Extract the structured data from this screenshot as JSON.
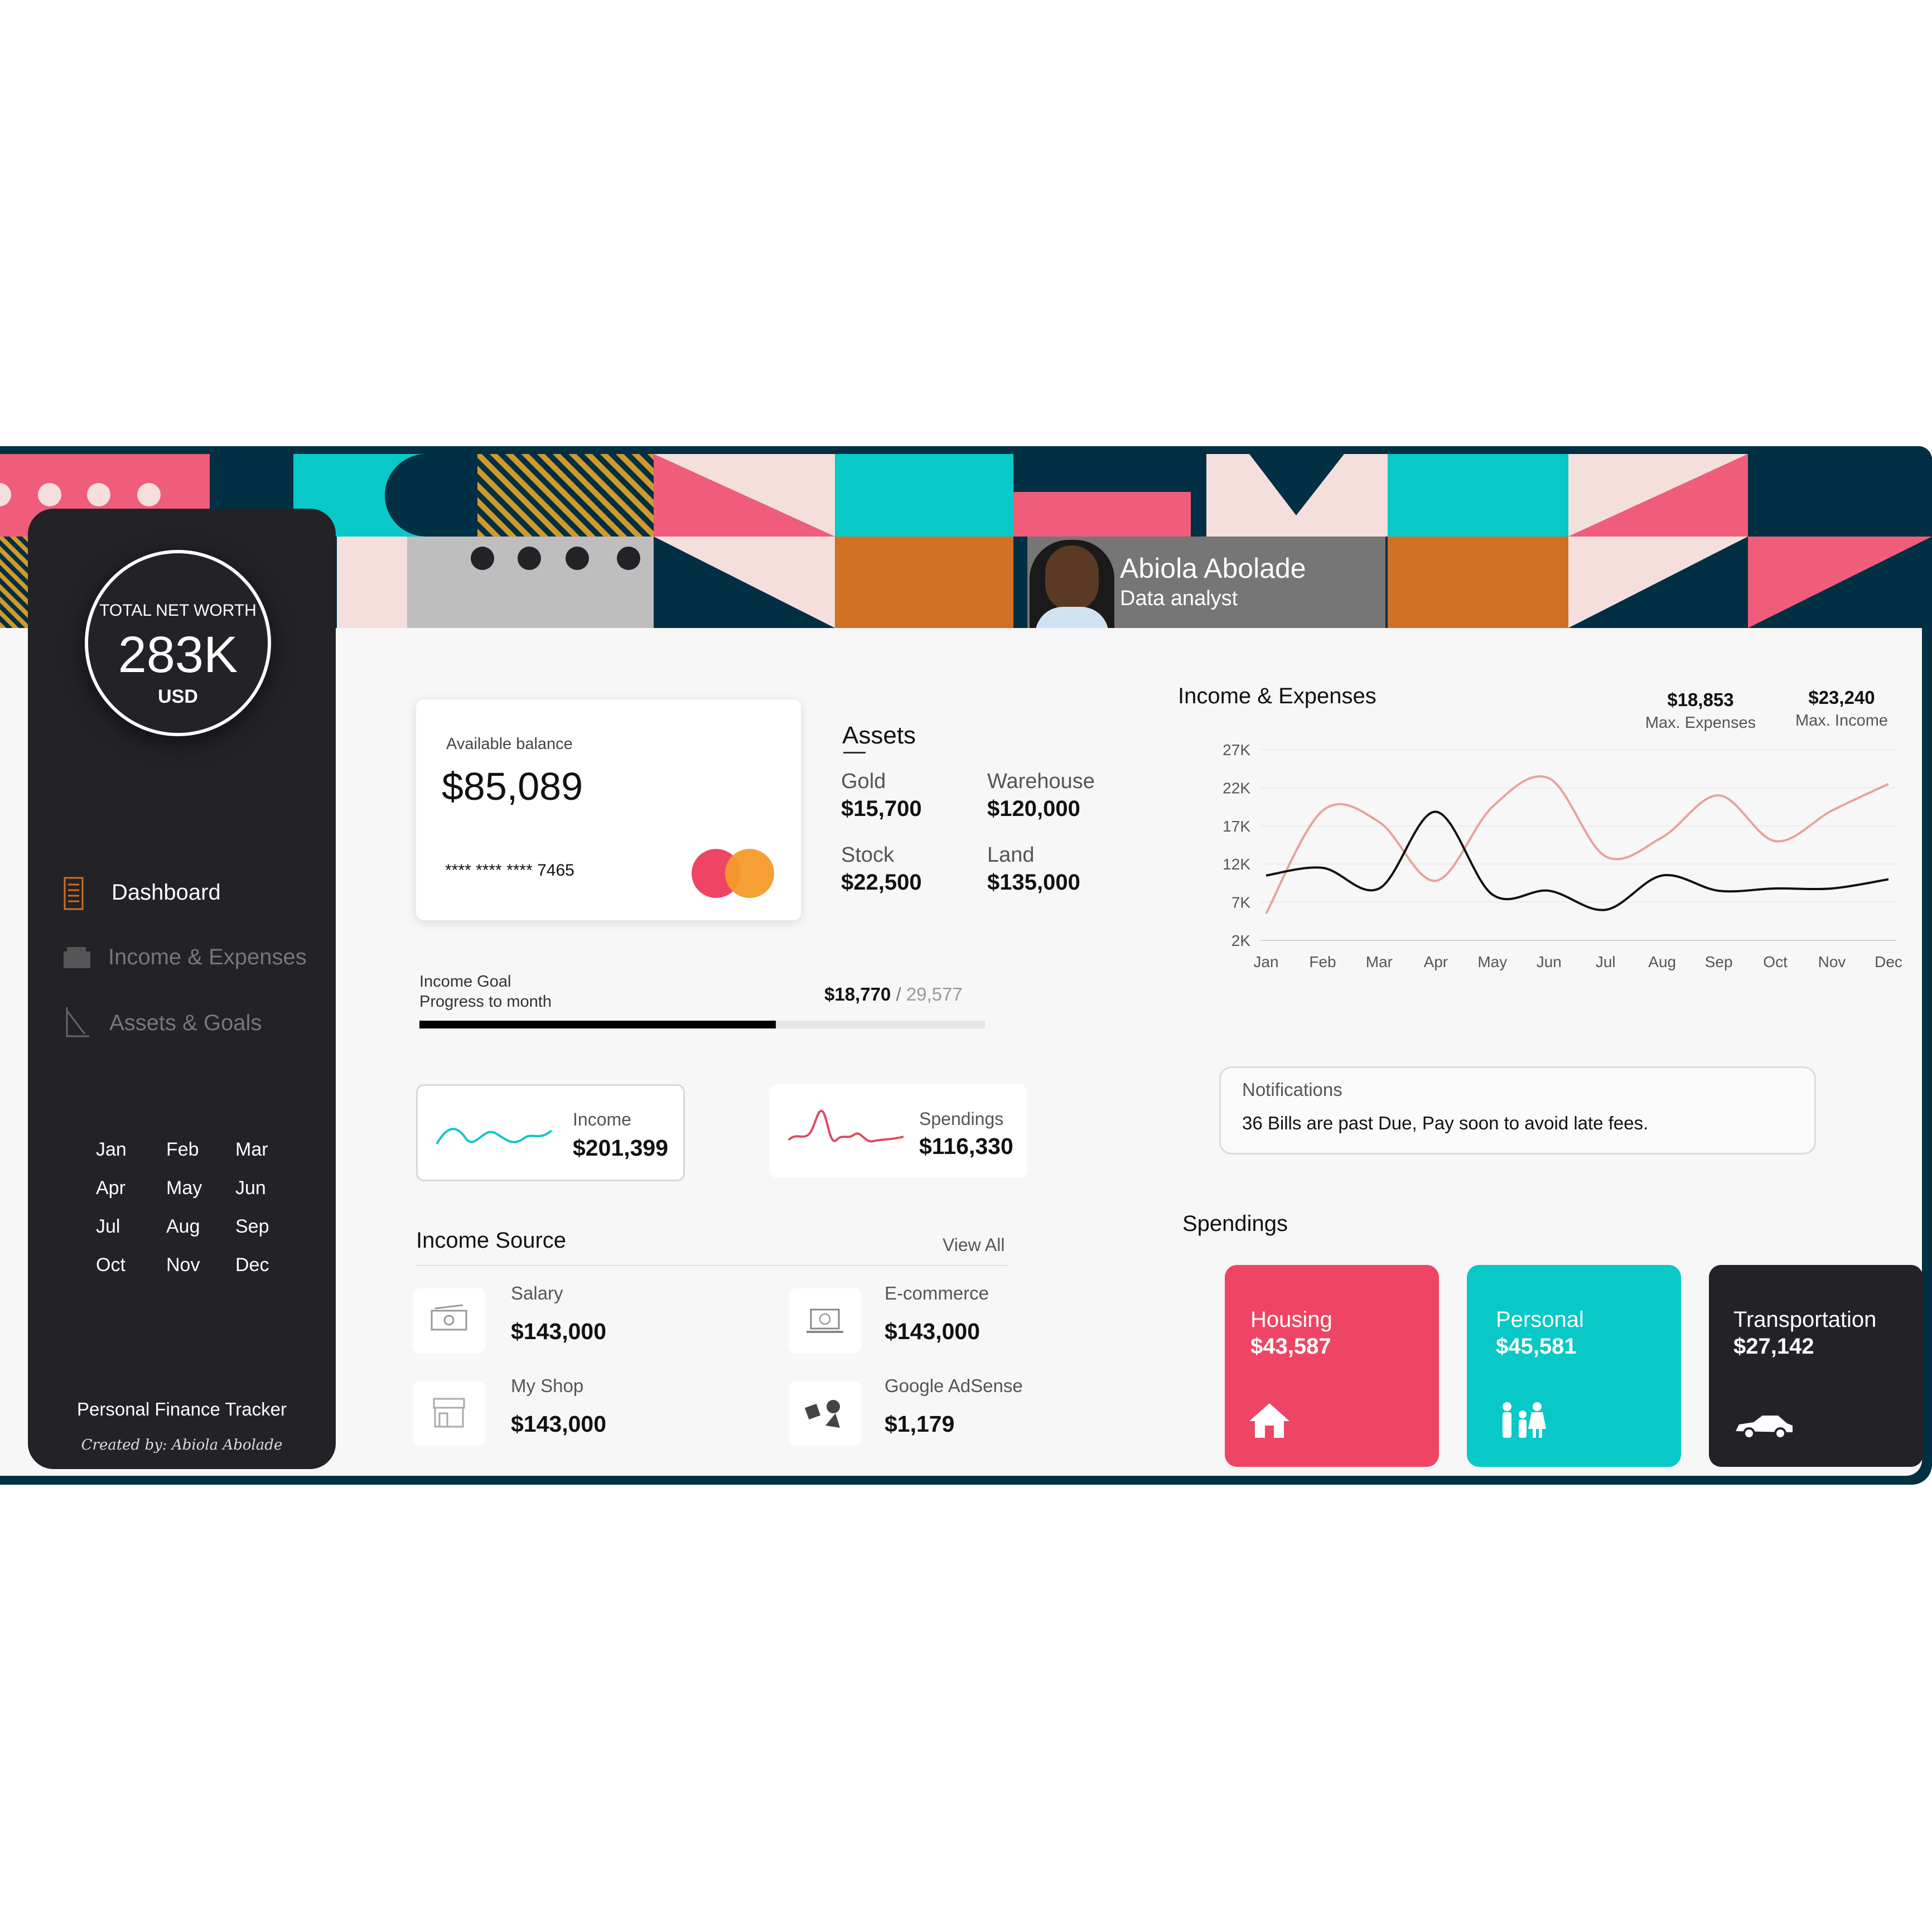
{
  "profile": {
    "name": "Abiola Abolade",
    "role": "Data analyst"
  },
  "net_worth": {
    "label": "TOTAL NET WORTH",
    "value": "283K",
    "unit": "USD"
  },
  "nav": [
    {
      "label": "Dashboard",
      "icon": "list-icon",
      "active": true
    },
    {
      "label": "Income & Expenses",
      "icon": "wallet-icon",
      "active": false
    },
    {
      "label": "Assets & Goals",
      "icon": "goal-icon",
      "active": false
    }
  ],
  "months": [
    "Jan",
    "Feb",
    "Mar",
    "Apr",
    "May",
    "Jun",
    "Jul",
    "Aug",
    "Sep",
    "Oct",
    "Nov",
    "Dec"
  ],
  "footer": {
    "title": "Personal Finance Tracker",
    "credit": "Created by: Abiola Abolade"
  },
  "balance": {
    "label": "Available balance",
    "value": "$85,089",
    "card_number": "**** **** **** 7465"
  },
  "assets": {
    "title": "Assets",
    "items": [
      {
        "label": "Gold",
        "value": "$15,700"
      },
      {
        "label": "Warehouse",
        "value": "$120,000"
      },
      {
        "label": "Stock",
        "value": "$22,500"
      },
      {
        "label": "Land",
        "value": "$135,000"
      }
    ]
  },
  "income_goal": {
    "label1": "Income Goal",
    "label2": "Progress to month",
    "current": "$18,770",
    "separator": "/",
    "target": "29,577",
    "progress": 0.63
  },
  "income_card": {
    "label": "Income",
    "value": "$201,399"
  },
  "spendings_card": {
    "label": "Spendings",
    "value": "$116,330"
  },
  "income_source": {
    "title": "Income Source",
    "view_all": "View All",
    "items": [
      {
        "label": "Salary",
        "value": "$143,000",
        "icon": "money-icon"
      },
      {
        "label": "E-commerce",
        "value": "$143,000",
        "icon": "laptop-icon"
      },
      {
        "label": "My Shop",
        "value": "$143,000",
        "icon": "shop-icon"
      },
      {
        "label": "Google AdSense",
        "value": "$1,179",
        "icon": "shapes-icon"
      }
    ]
  },
  "chart_header": {
    "title": "Income & Expenses",
    "max_expenses_value": "$18,853",
    "max_expenses_label": "Max. Expenses",
    "max_income_value": "$23,240",
    "max_income_label": "Max. Income"
  },
  "chart_data": {
    "type": "line",
    "categories": [
      "Jan",
      "Feb",
      "Mar",
      "Apr",
      "May",
      "Jun",
      "Jul",
      "Aug",
      "Sep",
      "Oct",
      "Nov",
      "Dec"
    ],
    "series": [
      {
        "color": "#e8a29c",
        "values": [
          5500,
          19000,
          17500,
          9800,
          19500,
          23240,
          13000,
          15500,
          21000,
          15000,
          19000,
          22500
        ]
      },
      {
        "color": "#111111",
        "values": [
          10500,
          11500,
          8800,
          18853,
          8000,
          8500,
          6000,
          10500,
          8500,
          8800,
          8800,
          10000
        ]
      }
    ],
    "yticks": [
      "2K",
      "7K",
      "12K",
      "17K",
      "22K",
      "27K"
    ],
    "ylim": [
      2000,
      27000
    ],
    "grid": true
  },
  "notifications": {
    "title": "Notifications",
    "message": "36 Bills are past Due, Pay soon to avoid late fees."
  },
  "spendings": {
    "title": "Spendings",
    "items": [
      {
        "label": "Housing",
        "value": "$43,587",
        "icon": "house-icon",
        "color": "#ef4565"
      },
      {
        "label": "Personal",
        "value": "$45,581",
        "icon": "family-icon",
        "color": "#08c8c8"
      },
      {
        "label": "Transportation",
        "value": "$27,142",
        "icon": "car-icon",
        "color": "#222227"
      }
    ]
  },
  "colors": {
    "teal": "#08c8c8",
    "pink": "#ef5d7a",
    "orange": "#cf7025",
    "navy": "#012f43",
    "blush": "#f4dfdc",
    "dark": "#222227"
  }
}
